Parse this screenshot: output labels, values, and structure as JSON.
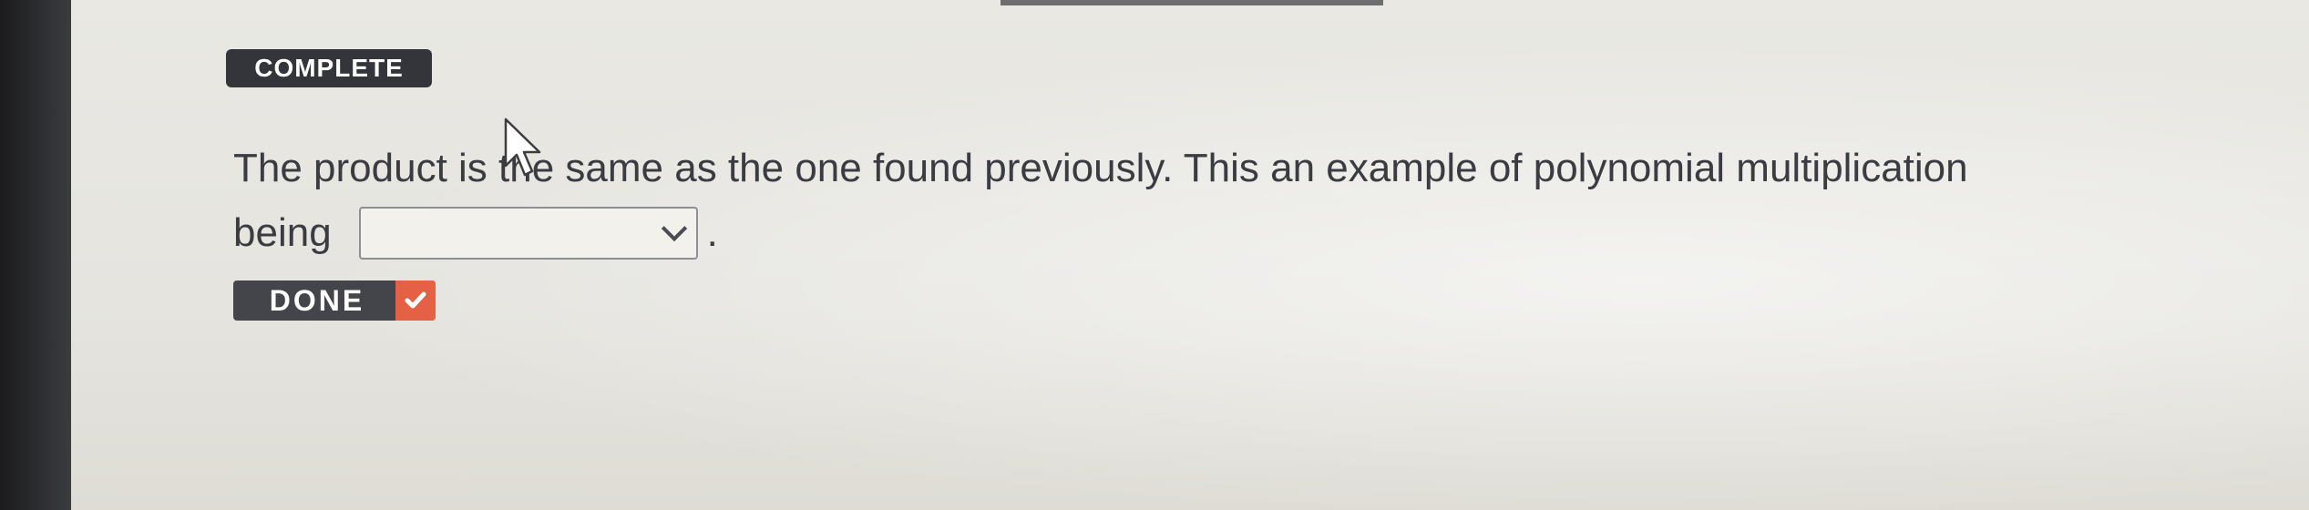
{
  "status_badge": {
    "label": "COMPLETE"
  },
  "question": {
    "sentence_line1": "The product is the same as the one found previously. This an example of polynomial multiplication",
    "sentence_line2_prefix": "being",
    "sentence_line2_suffix": "."
  },
  "answer_dropdown": {
    "selected_value": "",
    "icon": "chevron-down-icon"
  },
  "done_button": {
    "label": "DONE",
    "icon": "checkmark-icon",
    "icon_color": "#e46145"
  },
  "colors": {
    "badge_bg": "#34353a",
    "text": "#3b3c42",
    "screen_bg": "#e6e5df"
  }
}
